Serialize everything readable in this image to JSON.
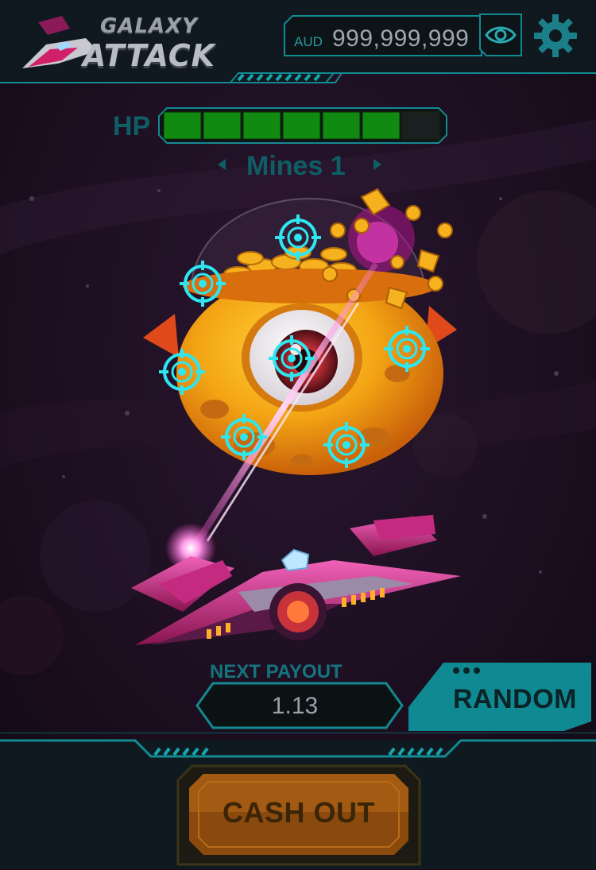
{
  "header": {
    "logo_line1": "GALAXY",
    "logo_line2": "ATTACK",
    "balance_currency": "AUD",
    "balance_amount": "999,999,999",
    "eye_icon": "eye-icon",
    "settings_icon": "gear-icon"
  },
  "hp": {
    "label": "HP",
    "segments_total": 7,
    "segments_filled": 6
  },
  "mines": {
    "label": "Mines 1",
    "prev_icon": "triangle-left-icon",
    "next_icon": "triangle-right-icon"
  },
  "targets_icon": "crosshair-icon",
  "payout": {
    "label": "NEXT PAYOUT",
    "value": "1.13"
  },
  "random": {
    "label": "RANDOM"
  },
  "cashout": {
    "label": "CASH OUT"
  },
  "colors": {
    "accent_teal": "#18a5ad",
    "hp_green": "#108a10",
    "crosshair": "#2ee6f0",
    "cashout_orange": "#a35a12",
    "background": "#1a0d1c"
  }
}
